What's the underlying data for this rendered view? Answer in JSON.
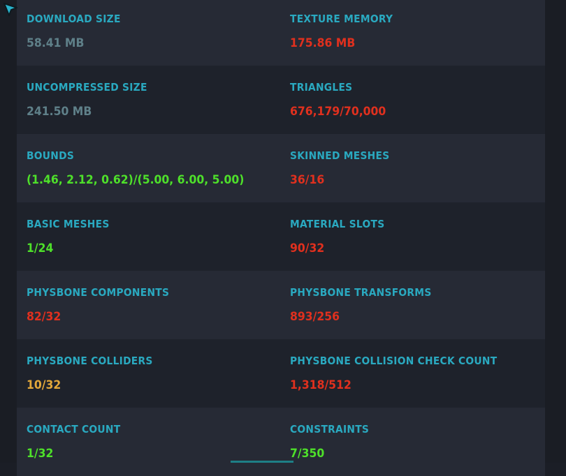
{
  "stats": [
    {
      "label": "DOWNLOAD SIZE",
      "value": "58.41 MB",
      "status": "gray"
    },
    {
      "label": "TEXTURE MEMORY",
      "value": "175.86 MB",
      "status": "red"
    },
    {
      "label": "UNCOMPRESSED SIZE",
      "value": "241.50 MB",
      "status": "gray"
    },
    {
      "label": "TRIANGLES",
      "value": "676,179/70,000",
      "status": "red"
    },
    {
      "label": "BOUNDS",
      "value": "(1.46, 2.12, 0.62)/(5.00, 6.00, 5.00)",
      "status": "green"
    },
    {
      "label": "SKINNED MESHES",
      "value": "36/16",
      "status": "red"
    },
    {
      "label": "BASIC MESHES",
      "value": "1/24",
      "status": "green"
    },
    {
      "label": "MATERIAL SLOTS",
      "value": "90/32",
      "status": "red"
    },
    {
      "label": "PHYSBONE COMPONENTS",
      "value": "82/32",
      "status": "red"
    },
    {
      "label": "PHYSBONE TRANSFORMS",
      "value": "893/256",
      "status": "red"
    },
    {
      "label": "PHYSBONE COLLIDERS",
      "value": "10/32",
      "status": "orange"
    },
    {
      "label": "PHYSBONE COLLISION CHECK COUNT",
      "value": "1,318/512",
      "status": "red"
    },
    {
      "label": "CONTACT COUNT",
      "value": "1/32",
      "status": "green"
    },
    {
      "label": "CONSTRAINTS",
      "value": "7/350",
      "status": "green"
    }
  ],
  "colors": {
    "label": "#2aa9c0",
    "gray": "#5f8089",
    "red": "#e0301e",
    "green": "#4ee02a",
    "orange": "#e3a83a"
  }
}
